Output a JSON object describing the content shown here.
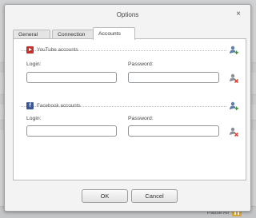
{
  "dialog": {
    "title": "Options",
    "close_glyph": "×"
  },
  "tabs": [
    {
      "label": "General"
    },
    {
      "label": "Connection"
    },
    {
      "label": "Accounts",
      "active": true
    }
  ],
  "youtube": {
    "section_label": "YouTube accounts",
    "login_label": "Login:",
    "password_label": "Password:",
    "login_value": "",
    "password_value": ""
  },
  "facebook": {
    "section_label": "Facebook accounts",
    "login_label": "Login:",
    "password_label": "Password:",
    "login_value": "",
    "password_value": ""
  },
  "buttons": {
    "ok": "OK",
    "cancel": "Cancel"
  },
  "background_app": {
    "pause_label": "Pause All"
  },
  "icons": {
    "add": "add-account-icon",
    "delete": "delete-account-icon",
    "youtube": "youtube-icon",
    "facebook": "facebook-icon"
  },
  "colors": {
    "youtube_red": "#c4302b",
    "facebook_blue": "#3b5998",
    "add_green": "#3aa02c",
    "delete_red": "#d0392b"
  }
}
